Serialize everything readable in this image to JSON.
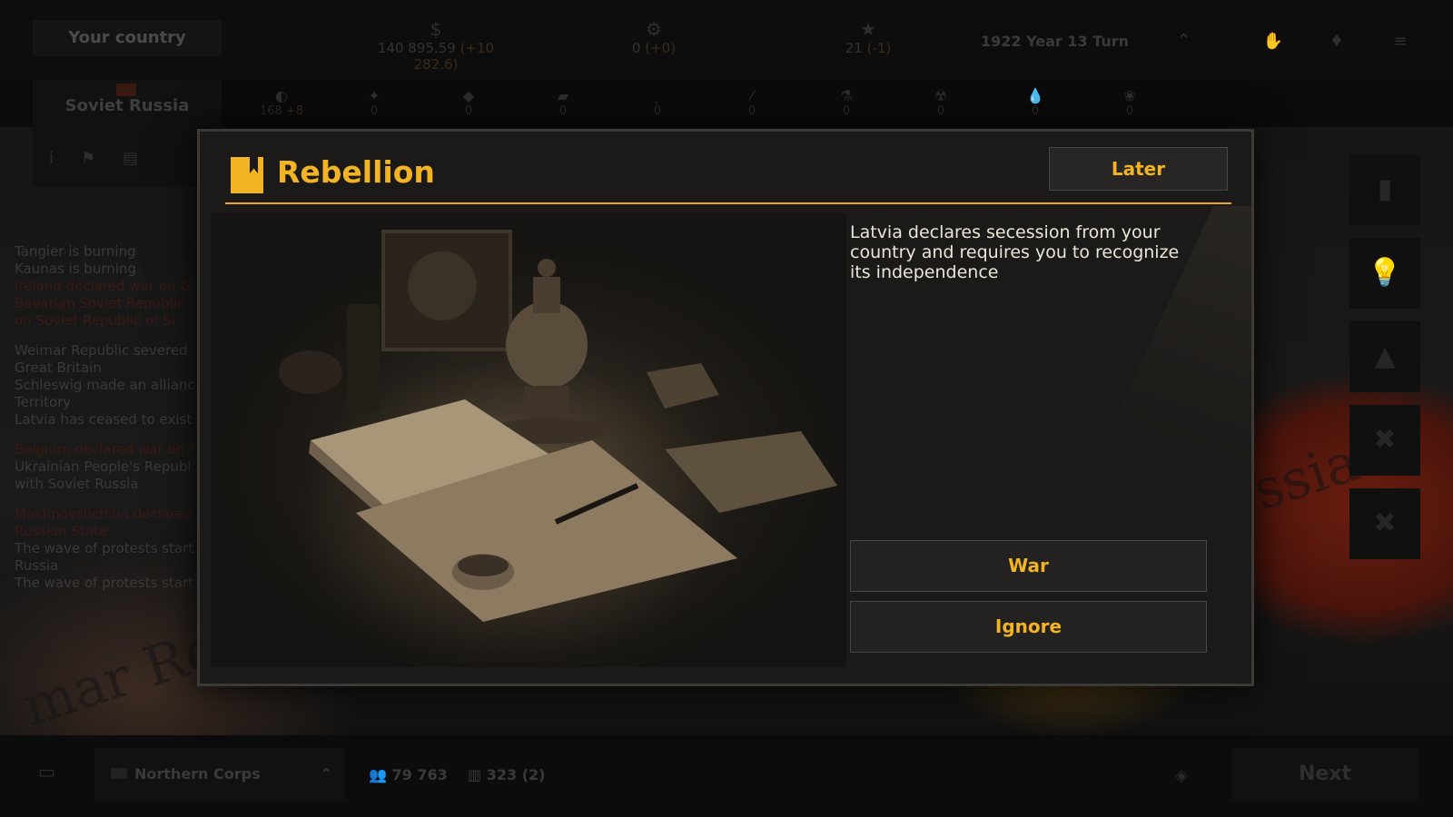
{
  "top_bar": {
    "country_tab": "Your country",
    "money": {
      "icon": "dollar-icon",
      "value": "140 895.59",
      "delta": "(+10 282.6)"
    },
    "science": {
      "icon": "gear-icon",
      "value": "0",
      "delta": "(+0)"
    },
    "prestige": {
      "icon": "star-icon",
      "value": "21",
      "delta": "(-1)"
    },
    "date": "1922 Year 13 Turn"
  },
  "side_panel": {
    "country_name": "Soviet Russia"
  },
  "resources": [
    {
      "icon": "food-icon",
      "value": "168",
      "delta": "+8"
    },
    {
      "icon": "ore-icon",
      "value": "0"
    },
    {
      "icon": "metal-icon",
      "value": "0"
    },
    {
      "icon": "wood-icon",
      "value": "0"
    },
    {
      "icon": "coal-icon",
      "value": "0"
    },
    {
      "icon": "weapons-icon",
      "value": "0"
    },
    {
      "icon": "chemicals-icon",
      "value": "0"
    },
    {
      "icon": "uranium-icon",
      "value": "0"
    },
    {
      "icon": "oil-icon",
      "value": "0"
    },
    {
      "icon": "rubber-icon",
      "value": "0"
    }
  ],
  "news": [
    {
      "lines": [
        "Tangier is burning",
        "Kaunas is burning",
        "Ireland declared war on G",
        "Bavarian Soviet Republic",
        "on Soviet Republic of Si"
      ]
    },
    {
      "lines": [
        "Weimar Republic severed",
        "Great Britain",
        "Schleswig made an allianc",
        "Territory",
        "Latvia has ceased to exist"
      ]
    },
    {
      "lines": [
        "Belgium declared war on F",
        "Ukrainian People's Republ",
        "with Soviet Russia"
      ]
    },
    {
      "lines": [
        "Makhnovshchina declared",
        "Russian State",
        "The wave of protests start",
        "Russia",
        "The wave of protests start"
      ]
    }
  ],
  "map_labels": {
    "east": "ssia",
    "west": "mar Repu"
  },
  "bottom_bar": {
    "corps_name": "Northern Corps",
    "troops": "79 763",
    "buildings": "323 (2)",
    "next_label": "Next"
  },
  "modal": {
    "title": "Rebellion",
    "later_label": "Later",
    "description": "Latvia declares secession from your country and requires you to recognize its independence",
    "war_label": "War",
    "ignore_label": "Ignore"
  },
  "colors": {
    "accent": "#f2b325",
    "modal_bg": "#1c1a18",
    "button_bg": "#242220"
  }
}
